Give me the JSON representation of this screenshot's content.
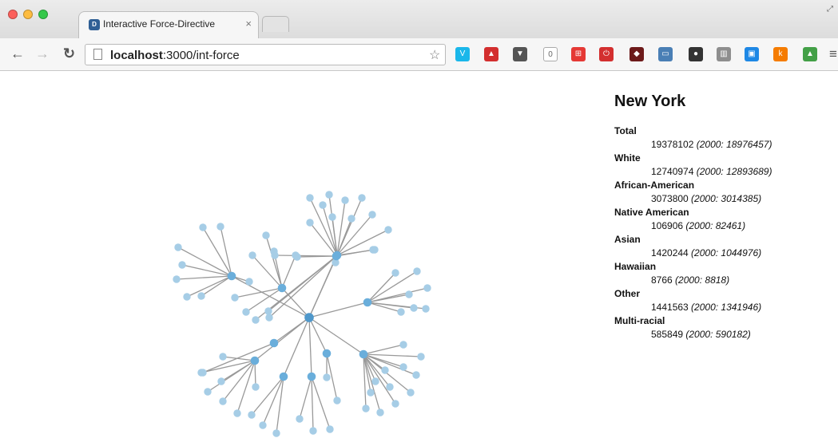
{
  "browser": {
    "tab_title": "Interactive Force-Directive",
    "tab_close": "×",
    "url_host": "localhost",
    "url_path": ":3000/int-force",
    "star": "☆",
    "extensions": [
      {
        "name": "vimeo",
        "color": "#1ab7ea",
        "label": "V"
      },
      {
        "name": "couch",
        "color": "#d32f2f",
        "label": "▲"
      },
      {
        "name": "pocket",
        "color": "#555555",
        "label": "▼"
      },
      {
        "name": "counter",
        "color": "#ffffff",
        "label": "0"
      },
      {
        "name": "grid",
        "color": "#e53935",
        "label": "⊞"
      },
      {
        "name": "stop",
        "color": "#d32f2f",
        "label": "⏻"
      },
      {
        "name": "fox",
        "color": "#6d1a1a",
        "label": "◆"
      },
      {
        "name": "tabs",
        "color": "#4a7fb5",
        "label": "▭"
      },
      {
        "name": "color-wheel",
        "color": "#333333",
        "label": "●"
      },
      {
        "name": "book",
        "color": "#8e8e8e",
        "label": "▥"
      },
      {
        "name": "screen",
        "color": "#1e88e5",
        "label": "▣"
      },
      {
        "name": "k",
        "color": "#f57c00",
        "label": "k"
      },
      {
        "name": "landscape",
        "color": "#43a047",
        "label": "▲"
      }
    ],
    "menu": "≡"
  },
  "info": {
    "city": "New York",
    "stats": [
      {
        "label": "Total",
        "value": "19378102",
        "previous": "(2000: 18976457)"
      },
      {
        "label": "White",
        "value": "12740974",
        "previous": "(2000: 12893689)"
      },
      {
        "label": "African-American",
        "value": "3073800",
        "previous": "(2000: 3014385)"
      },
      {
        "label": "Native American",
        "value": "106906",
        "previous": "(2000: 82461)"
      },
      {
        "label": "Asian",
        "value": "1420244",
        "previous": "(2000: 1044976)"
      },
      {
        "label": "Hawaiian",
        "value": "8766",
        "previous": "(2000: 8818)"
      },
      {
        "label": "Other",
        "value": "1441563",
        "previous": "(2000: 1341946)"
      },
      {
        "label": "Multi-racial",
        "value": "585849",
        "previous": "(2000: 590182)"
      }
    ]
  },
  "graph": {
    "colors": {
      "root": "#4f98cb",
      "hub": "#6aaedb",
      "leaf": "#a6cde6",
      "link": "#999999"
    },
    "hubs": [
      {
        "name": "hub-north",
        "leaves": 10
      },
      {
        "name": "hub-east",
        "leaves": 7
      },
      {
        "name": "hub-south-east",
        "leaves": 12
      },
      {
        "name": "hub-south-a",
        "leaves": 2
      },
      {
        "name": "hub-south-b",
        "leaves": 3
      },
      {
        "name": "hub-south-c",
        "leaves": 3
      },
      {
        "name": "hub-south-west",
        "leaves": 7
      },
      {
        "name": "hub-west-small",
        "leaves": 1
      },
      {
        "name": "hub-west",
        "leaves": 8
      },
      {
        "name": "hub-north-west",
        "leaves": 6
      },
      {
        "name": "hub-upper-west",
        "leaves": 8
      }
    ]
  }
}
